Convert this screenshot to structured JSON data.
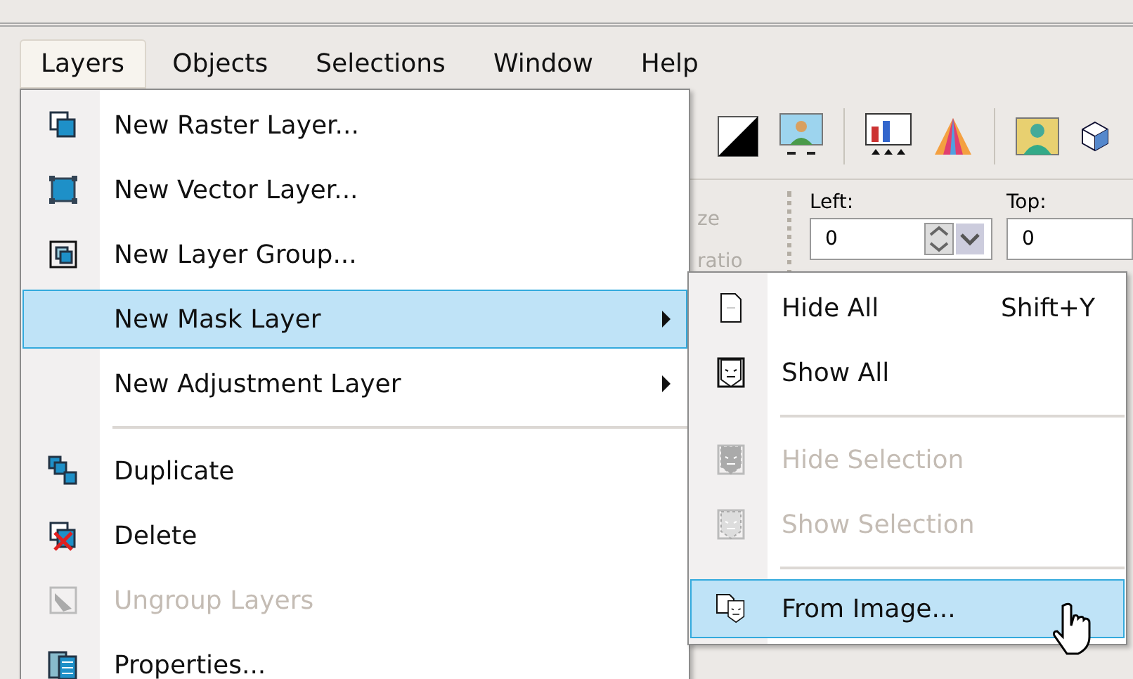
{
  "menu_bar": [
    {
      "label": "Layers",
      "selected": true
    },
    {
      "label": "Objects",
      "selected": false
    },
    {
      "label": "Selections",
      "selected": false
    },
    {
      "label": "Window",
      "selected": false
    },
    {
      "label": "Help",
      "selected": false
    }
  ],
  "properties_panel": {
    "partial_labels": [
      "ze",
      "ratio"
    ],
    "fields": [
      {
        "label": "Left:",
        "value": "0",
        "spinner": true
      },
      {
        "label": "Top:",
        "value": "0",
        "spinner": false
      }
    ]
  },
  "layers_menu": [
    {
      "kind": "command",
      "label": "New Raster Layer...",
      "disabled": false,
      "selected": false,
      "submenu": false
    },
    {
      "kind": "command",
      "label": "New Vector Layer...",
      "disabled": false,
      "selected": false,
      "submenu": false
    },
    {
      "kind": "command",
      "label": "New Layer Group...",
      "disabled": false,
      "selected": false,
      "submenu": false
    },
    {
      "kind": "command",
      "label": "New Mask Layer",
      "disabled": false,
      "selected": true,
      "submenu": true
    },
    {
      "kind": "command",
      "label": "New Adjustment Layer",
      "disabled": false,
      "selected": false,
      "submenu": true
    },
    {
      "kind": "separator"
    },
    {
      "kind": "command",
      "label": "Duplicate",
      "disabled": false,
      "selected": false,
      "submenu": false
    },
    {
      "kind": "command",
      "label": "Delete",
      "disabled": false,
      "selected": false,
      "submenu": false
    },
    {
      "kind": "command",
      "label": "Ungroup Layers",
      "disabled": true,
      "selected": false,
      "submenu": false
    },
    {
      "kind": "command",
      "label": "Properties...",
      "disabled": false,
      "selected": false,
      "submenu": false
    }
  ],
  "mask_submenu": [
    {
      "kind": "command",
      "label": "Hide All",
      "shortcut": "Shift+Y",
      "disabled": false,
      "selected": false
    },
    {
      "kind": "command",
      "label": "Show All",
      "disabled": false,
      "selected": false
    },
    {
      "kind": "separator"
    },
    {
      "kind": "command",
      "label": "Hide Selection",
      "disabled": true,
      "selected": false
    },
    {
      "kind": "command",
      "label": "Show Selection",
      "disabled": true,
      "selected": false
    },
    {
      "kind": "separator"
    },
    {
      "kind": "command",
      "label": "From Image...",
      "disabled": false,
      "selected": true
    }
  ]
}
